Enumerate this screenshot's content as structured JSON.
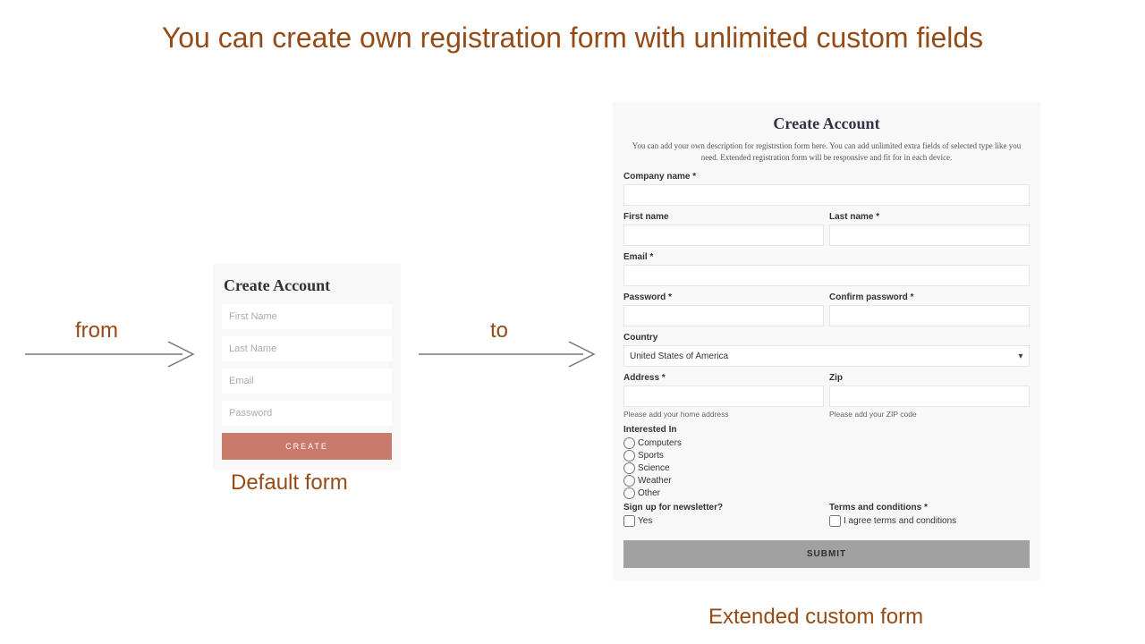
{
  "headline": "You can create own registration form with unlimited custom fields",
  "labels": {
    "from": "from",
    "to": "to",
    "default_caption": "Default form",
    "extended_caption": "Extended custom form"
  },
  "default_form": {
    "title": "Create Account",
    "first_name_ph": "First Name",
    "last_name_ph": "Last Name",
    "email_ph": "Email",
    "password_ph": "Password",
    "create_label": "CREATE"
  },
  "ext_form": {
    "title": "Create Account",
    "description": "You can add your own description for registrstion form here. You can add unlimited extra fields of selected type like you need. Extended registration form will be responsive and fit for in each device.",
    "company_label": "Company name *",
    "firstname_label": "First name",
    "lastname_label": "Last name *",
    "email_label": "Email *",
    "password_label": "Password *",
    "confirm_label": "Confirm password *",
    "country_label": "Country",
    "country_value": "United States of America",
    "address_label": "Address *",
    "zip_label": "Zip",
    "address_hint": "Please add your home address",
    "zip_hint": "Please add your ZIP code",
    "interested_label": "Interested In",
    "interests": [
      "Computers",
      "Sports",
      "Science",
      "Weather",
      "Other"
    ],
    "newsletter_label": "Sign up for newsletter?",
    "newsletter_option": "Yes",
    "terms_label": "Terms and conditions *",
    "terms_option": "I agree terms and conditions",
    "submit_label": "SUBMIT"
  }
}
